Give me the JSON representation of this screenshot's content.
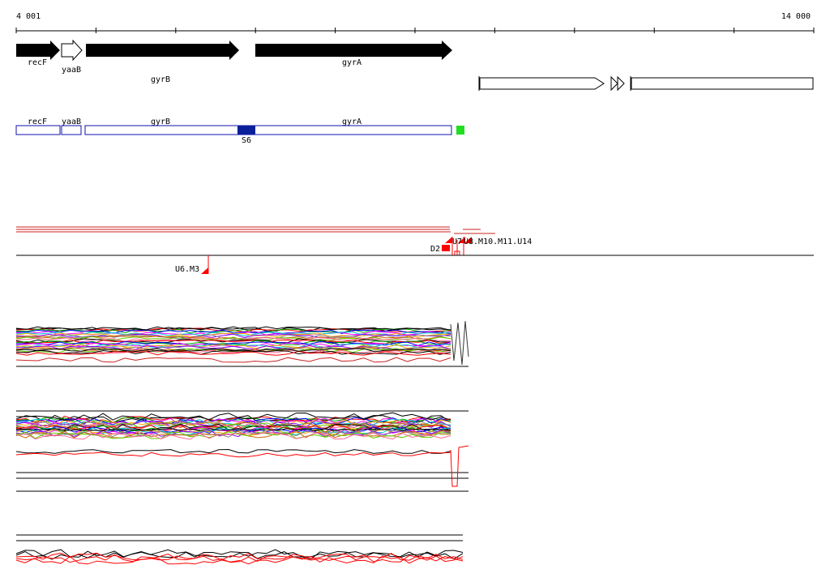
{
  "ruler": {
    "start_label": "4 001",
    "end_label": "14 000"
  },
  "gene_track": {
    "labels": [
      "recF",
      "yaaB",
      "gyrB",
      "gyrA"
    ]
  },
  "cds_track": {
    "labels": [
      "recF",
      "yaaB",
      "gyrB",
      "gyrA"
    ],
    "marker_label": "S6",
    "colors": {
      "outline": "#1010b0",
      "marker": "#0a1f9a",
      "green_tag": "#22dd22"
    }
  },
  "probe_track": {
    "labels": {
      "d2": "D2",
      "u7": "U7",
      "u6m3": "U6.M3",
      "overlap": "U8.M10.M11.U14"
    },
    "colors": {
      "probe": "#ff0000",
      "line": "#cc2222"
    }
  },
  "signal_tracks": {
    "count": 3,
    "colors": [
      "#000000",
      "#ff0000",
      "#00aa00",
      "#0000ff",
      "#ff00ff",
      "#00cccc",
      "#ffaa00",
      "#8800ff",
      "#888888",
      "#cc6600",
      "#66cc00",
      "#ff6699"
    ]
  }
}
